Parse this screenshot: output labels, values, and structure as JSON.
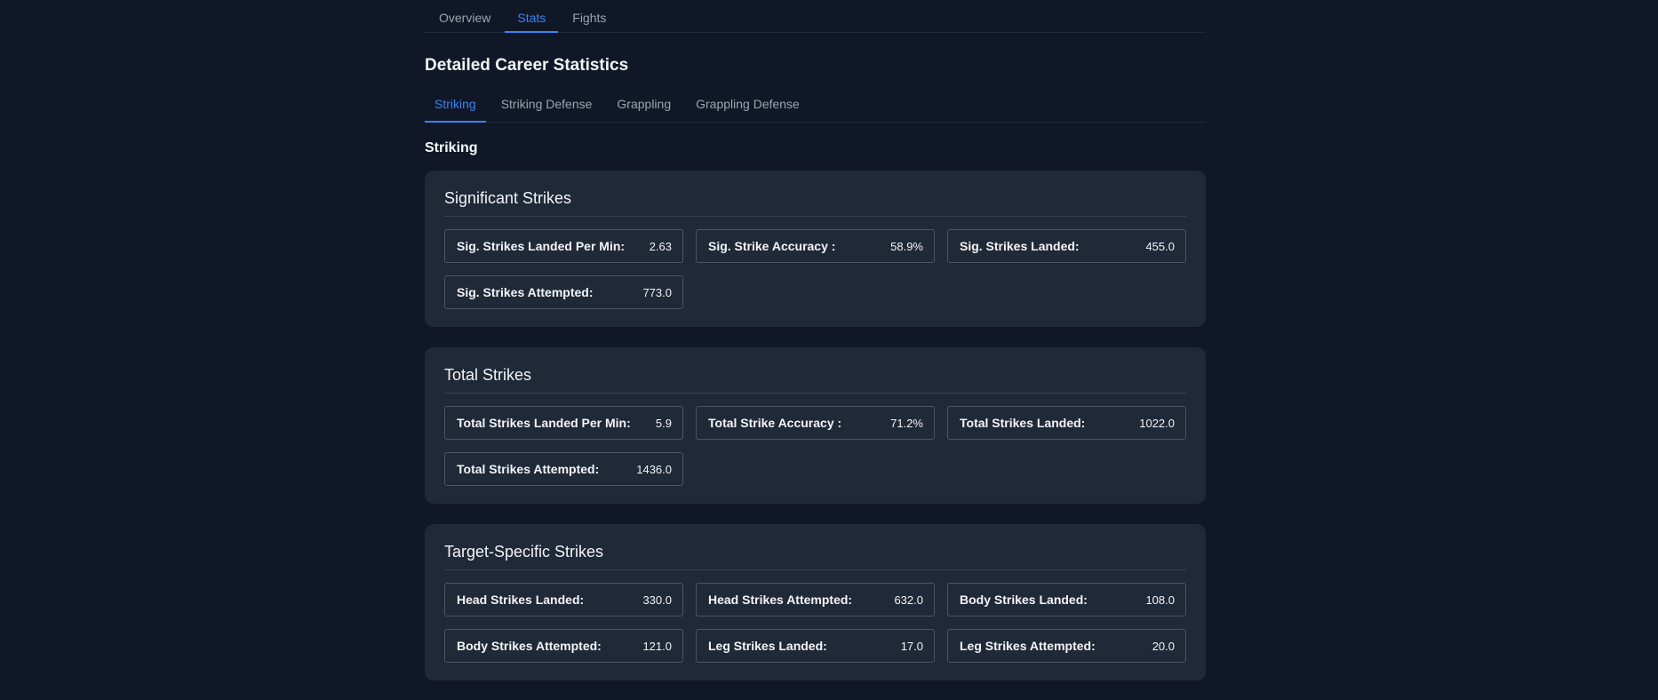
{
  "top_tabs": [
    {
      "label": "Overview",
      "active": false
    },
    {
      "label": "Stats",
      "active": true
    },
    {
      "label": "Fights",
      "active": false
    }
  ],
  "page_title": "Detailed Career Statistics",
  "sub_tabs": [
    {
      "label": "Striking",
      "active": true
    },
    {
      "label": "Striking Defense",
      "active": false
    },
    {
      "label": "Grappling",
      "active": false
    },
    {
      "label": "Grappling Defense",
      "active": false
    }
  ],
  "section_heading": "Striking",
  "cards": [
    {
      "title": "Significant Strikes",
      "stats": [
        {
          "label": "Sig. Strikes Landed Per Min:",
          "value": "2.63"
        },
        {
          "label": "Sig. Strike Accuracy :",
          "value": "58.9%"
        },
        {
          "label": "Sig. Strikes Landed:",
          "value": "455.0"
        },
        {
          "label": "Sig. Strikes Attempted:",
          "value": "773.0"
        }
      ]
    },
    {
      "title": "Total Strikes",
      "stats": [
        {
          "label": "Total Strikes Landed Per Min:",
          "value": "5.9"
        },
        {
          "label": "Total Strike Accuracy :",
          "value": "71.2%"
        },
        {
          "label": "Total Strikes Landed:",
          "value": "1022.0"
        },
        {
          "label": "Total Strikes Attempted:",
          "value": "1436.0"
        }
      ]
    },
    {
      "title": "Target-Specific Strikes",
      "stats": [
        {
          "label": "Head Strikes Landed:",
          "value": "330.0"
        },
        {
          "label": "Head Strikes Attempted:",
          "value": "632.0"
        },
        {
          "label": "Body Strikes Landed:",
          "value": "108.0"
        },
        {
          "label": "Body Strikes Attempted:",
          "value": "121.0"
        },
        {
          "label": "Leg Strikes Landed:",
          "value": "17.0"
        },
        {
          "label": "Leg Strikes Attempted:",
          "value": "20.0"
        }
      ]
    }
  ]
}
